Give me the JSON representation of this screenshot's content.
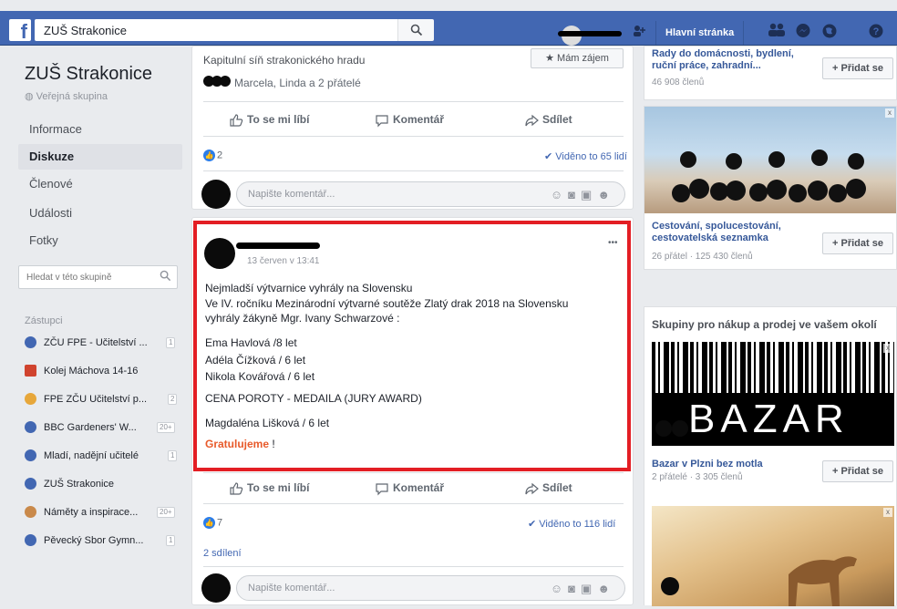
{
  "topbar": {
    "search_value": "ZUŠ Strakonice",
    "home_label": "Hlavní stránka"
  },
  "group": {
    "title": "ZUŠ Strakonice",
    "privacy": "Veřejná skupina",
    "nav": [
      "Informace",
      "Diskuze",
      "Členové",
      "Události",
      "Fotky"
    ],
    "search_placeholder": "Hledat v této skupině",
    "shortcuts_title": "Zástupci",
    "shortcuts": [
      {
        "label": "ZČU FPE - Učitelství ...",
        "badge": "1",
        "color": "#4267b2"
      },
      {
        "label": "Kolej Máchova 14-16",
        "badge": "",
        "color": "#d0432e"
      },
      {
        "label": "FPE ZČU Učitelství p...",
        "badge": "2",
        "color": "#e7a73a"
      },
      {
        "label": "BBC Gardeners' W...",
        "badge": "20+",
        "color": "#4267b2"
      },
      {
        "label": "Mladí, nadějní učitelé",
        "badge": "1",
        "color": "#4267b2"
      },
      {
        "label": "ZUŠ Strakonice",
        "badge": "",
        "color": "#4267b2"
      },
      {
        "label": "Náměty a inspirace...",
        "badge": "20+",
        "color": "#c9894a"
      },
      {
        "label": "Pěvecký Sbor Gymn...",
        "badge": "1",
        "color": "#4267b2"
      }
    ]
  },
  "post1": {
    "event_place": "Kapitulní síň strakonického hradu",
    "interested_label": "★ Mám zájem",
    "friends": "Marcela, Linda a 2 přátelé",
    "like_label": "To se mi líbí",
    "comment_label": "Komentář",
    "share_label": "Sdílet",
    "likes": "2",
    "seen": "✔ Viděno to 65 lidí",
    "comment_placeholder": "Napište komentář..."
  },
  "post2": {
    "time": "13 červen v 13:41",
    "more": "•••",
    "lines": [
      "Nejmladší výtvarnice vyhrály na Slovensku",
      "Ve IV. ročníku Mezinárodní výtvarné soutěže Zlatý drak 2018 na Slovensku",
      "vyhrály žákyně Mgr. Ivany Schwarzové :",
      "Ema Havlová /8 let",
      "Adéla Čížková / 6 let",
      "Nikola Kovářová / 6 let",
      "CENA POROTY - MEDAILA (JURY AWARD)",
      "Magdaléna Lišková / 6 let"
    ],
    "congrats": "Gratulujeme",
    "congrats_tail": " !",
    "like_label": "To se mi líbí",
    "comment_label": "Komentář",
    "share_label": "Sdílet",
    "likes": "7",
    "seen": "✔ Viděno to 116 lidí",
    "shares": "2 sdílení",
    "comment_placeholder": "Napište komentář..."
  },
  "right": {
    "group1": {
      "name": "Rady do domácnosti, bydlení, ruční práce, zahradní...",
      "meta": "46 908 členů",
      "join": "+ Přidat se"
    },
    "group2": {
      "name": "Cestování, spolucestování, cestovatelská seznamka",
      "meta": "26 přátel · 125 430 členů",
      "join": "+ Přidat se"
    },
    "section_title": "Skupiny pro nákup a prodej ve vašem okolí",
    "group3": {
      "name": "Bazar v Plzni bez motla",
      "meta": "2 přátelé · 3 305 členů",
      "join": "+ Přidat se",
      "image_text": "BAZAR"
    }
  }
}
